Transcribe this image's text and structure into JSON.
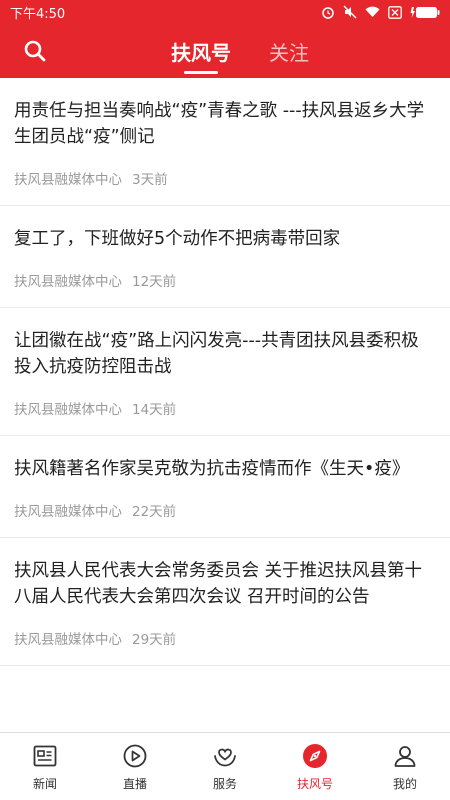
{
  "status_bar": {
    "time": "下午4:50"
  },
  "header": {
    "tabs": [
      {
        "label": "扶风号",
        "active": true
      },
      {
        "label": "关注",
        "active": false
      }
    ]
  },
  "articles": [
    {
      "title": "用责任与担当奏响战“疫”青春之歌 ---扶风县返乡大学生团员战“疫”侧记",
      "source": "扶风县融媒体中心",
      "time": "3天前"
    },
    {
      "title": "复工了，下班做好5个动作不把病毒带回家",
      "source": "扶风县融媒体中心",
      "time": "12天前"
    },
    {
      "title": "让团徽在战“疫”路上闪闪发亮---共青团扶风县委积极投入抗疫防控阻击战",
      "source": "扶风县融媒体中心",
      "time": "14天前"
    },
    {
      "title": "扶风籍著名作家吴克敬为抗击疫情而作《生天•疫》",
      "source": "扶风县融媒体中心",
      "time": "22天前"
    },
    {
      "title": "扶风县人民代表大会常务委员会 关于推迟扶风县第十八届人民代表大会第四次会议 召开时间的公告",
      "source": "扶风县融媒体中心",
      "time": "29天前"
    }
  ],
  "bottom_nav": [
    {
      "label": "新闻",
      "icon": "news-icon",
      "active": false
    },
    {
      "label": "直播",
      "icon": "play-icon",
      "active": false
    },
    {
      "label": "服务",
      "icon": "service-icon",
      "active": false
    },
    {
      "label": "扶风号",
      "icon": "compass-icon",
      "active": true
    },
    {
      "label": "我的",
      "icon": "person-icon",
      "active": false
    }
  ],
  "colors": {
    "brand": "#e5262c",
    "meta_text": "#9a9a9a",
    "title_text": "#222222"
  }
}
